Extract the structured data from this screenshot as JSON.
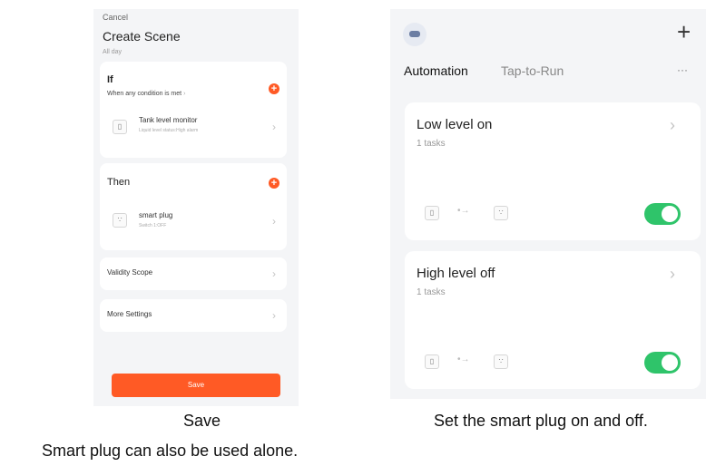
{
  "left_screen": {
    "cancel": "Cancel",
    "title": "Create Scene",
    "subtitle": "All day",
    "if_section": {
      "heading": "If",
      "condition_text": "When any condition is met",
      "device_name": "Tank level monitor",
      "device_detail": "Liquid level status:High alarm"
    },
    "then_section": {
      "heading": "Then",
      "device_name": "smart plug",
      "device_detail": "Switch 1:OFF"
    },
    "validity_scope": "Validity Scope",
    "more_settings": "More Settings",
    "save_button": "Save"
  },
  "right_screen": {
    "tab_automation": "Automation",
    "tab_tap_to_run": "Tap-to-Run",
    "more_label": "···",
    "add_label": "+",
    "scenes": [
      {
        "name": "Low level on",
        "tasks": "1 tasks",
        "enabled": true
      },
      {
        "name": "High level off",
        "tasks": "1 tasks",
        "enabled": true
      }
    ]
  },
  "captions": {
    "left": "Save",
    "right": "Set the smart plug on and off.",
    "bottom": "Smart plug can also be used alone."
  },
  "colors": {
    "accent": "#ff5a25",
    "toggle_on": "#2fc46a",
    "background": "#f4f5f7"
  },
  "icons": [
    "chevron-right-icon",
    "add-icon",
    "sensor-icon",
    "plug-icon",
    "arrow-icon",
    "menu-dots-icon",
    "profile-icon"
  ]
}
